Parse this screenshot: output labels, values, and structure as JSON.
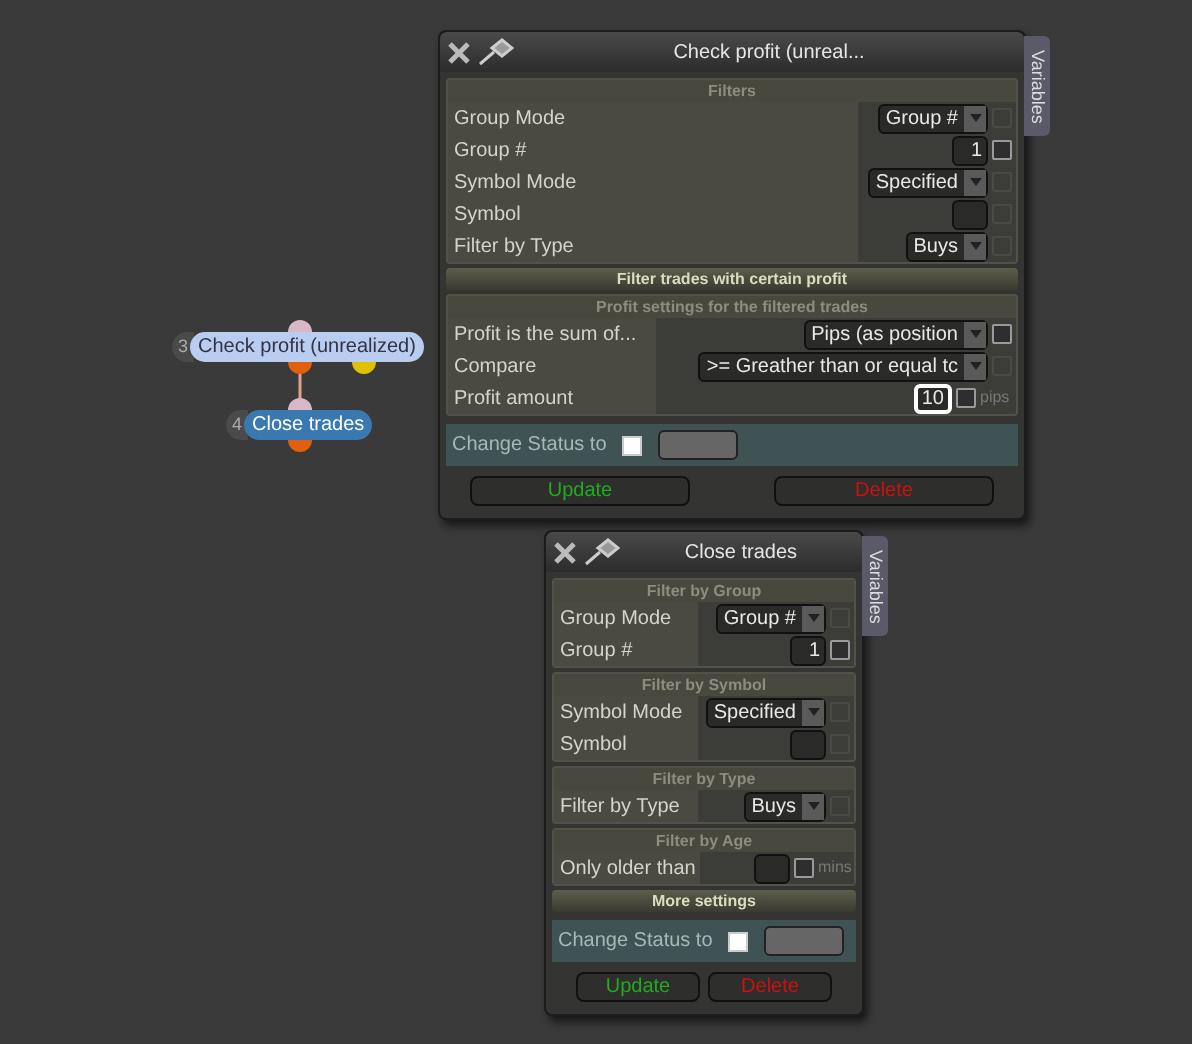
{
  "nodes": [
    {
      "number": "3",
      "label": "Check profit (unrealized)",
      "selected": false
    },
    {
      "number": "4",
      "label": "Close trades",
      "selected": true
    }
  ],
  "panels": [
    {
      "title": "Check profit (unreal...",
      "side_tab": "Variables",
      "blocks": [
        {
          "kind": "group",
          "heading": "Filters",
          "rows": [
            {
              "label": "Group Mode",
              "kind": "select",
              "value": "Group #",
              "check_disabled": true
            },
            {
              "label": "Group #",
              "kind": "number",
              "value": "1",
              "check_disabled": false
            },
            {
              "label": "Symbol Mode",
              "kind": "select",
              "value": "Specified",
              "check_disabled": true
            },
            {
              "label": "Symbol",
              "kind": "number",
              "check_disabled": true
            },
            {
              "label": "Filter by Type",
              "kind": "select",
              "value": "Buys",
              "check_disabled": true
            }
          ]
        },
        {
          "kind": "band",
          "heading": "Filter trades with certain profit"
        },
        {
          "kind": "group",
          "heading": "Profit settings for the filtered trades",
          "rows": [
            {
              "label": "Profit is the sum of...",
              "kind": "select",
              "value": "Pips (as position",
              "check_disabled": false
            },
            {
              "label": "Compare",
              "kind": "select",
              "value": ">= Greather than or equal tc",
              "check_disabled": true
            },
            {
              "label": "Profit amount",
              "kind": "number",
              "value": "10",
              "focused": true,
              "unit": "pips",
              "check_disabled": false
            }
          ]
        }
      ],
      "status": {
        "label": "Change Status to",
        "checked": false
      },
      "buttons": [
        {
          "label": "Update",
          "color": "#22aa22"
        },
        {
          "label": "Delete",
          "color": "#cc1111"
        }
      ]
    },
    {
      "title": "Close trades",
      "side_tab": "Variables",
      "blocks": [
        {
          "kind": "group",
          "heading": "Filter by Group",
          "rows": [
            {
              "label": "Group Mode",
              "kind": "select",
              "value": "Group #",
              "check_disabled": true
            },
            {
              "label": "Group #",
              "kind": "number",
              "value": "1",
              "check_disabled": false
            }
          ]
        },
        {
          "kind": "group",
          "heading": "Filter by Symbol",
          "rows": [
            {
              "label": "Symbol Mode",
              "kind": "select",
              "value": "Specified",
              "check_disabled": true
            },
            {
              "label": "Symbol",
              "kind": "number",
              "check_disabled": true
            }
          ]
        },
        {
          "kind": "group",
          "heading": "Filter by Type",
          "rows": [
            {
              "label": "Filter by Type",
              "kind": "select",
              "value": "Buys",
              "check_disabled": true
            }
          ]
        },
        {
          "kind": "group",
          "heading": "Filter by Age",
          "rows": [
            {
              "label": "Only older than",
              "kind": "number",
              "unit": "mins",
              "check_disabled": false
            }
          ]
        },
        {
          "kind": "band",
          "heading": "More settings"
        }
      ],
      "status": {
        "label": "Change Status to",
        "checked": false
      },
      "buttons": [
        {
          "label": "Update",
          "color": "#22aa22"
        },
        {
          "label": "Delete",
          "color": "#cc1111"
        }
      ]
    }
  ]
}
